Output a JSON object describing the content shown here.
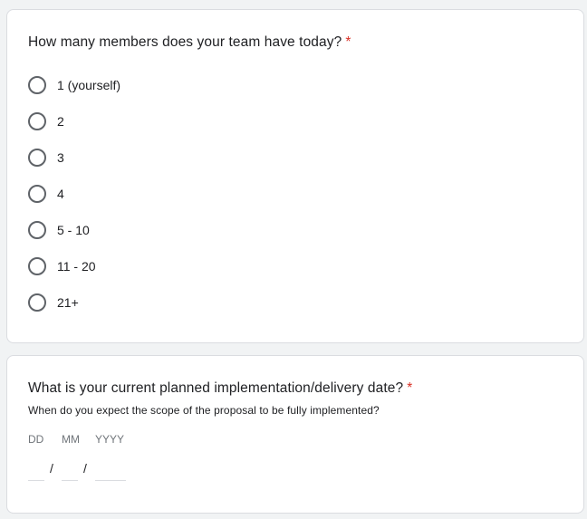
{
  "questions": {
    "team_size": {
      "title": "How many members does your team have today?",
      "required_mark": "*",
      "options": [
        {
          "label": "1 (yourself)"
        },
        {
          "label": "2"
        },
        {
          "label": "3"
        },
        {
          "label": "4"
        },
        {
          "label": "5 - 10"
        },
        {
          "label": "11 - 20"
        },
        {
          "label": "21+"
        }
      ]
    },
    "delivery_date": {
      "title": "What is your current planned implementation/delivery date?",
      "required_mark": "*",
      "description": "When do you expect the scope of the proposal to be fully implemented?",
      "labels": {
        "day": "DD",
        "month": "MM",
        "year": "YYYY"
      },
      "separator": "/",
      "values": {
        "day": "",
        "month": "",
        "year": ""
      }
    }
  },
  "colors": {
    "required": "#d93025",
    "radio_border": "#5f6368",
    "card_border": "#dadce0",
    "background": "#f1f3f4"
  }
}
